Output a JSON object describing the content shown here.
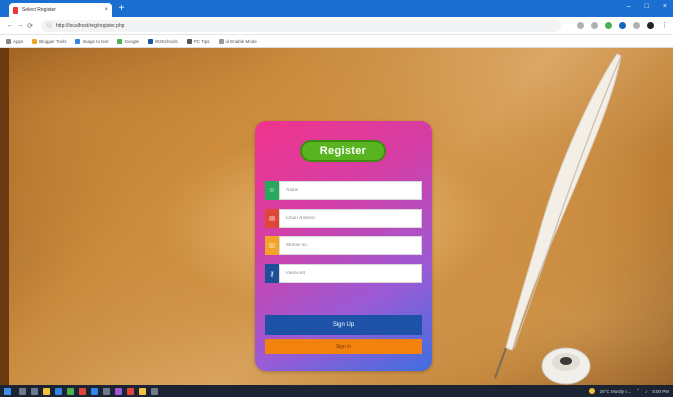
{
  "browser": {
    "tab_title": "Select Register",
    "tab_close": "×",
    "new_tab": "+",
    "window_controls": [
      "–",
      "□",
      "×"
    ],
    "url": "http://localhost/reg/register.php",
    "bookmarks": [
      "Apps",
      "Blogger Tools",
      "Image to text",
      "Google",
      "W3Schools",
      "PC Tips",
      "ul Enable Mode"
    ]
  },
  "form": {
    "title": "Register",
    "name_placeholder": "Name",
    "email_placeholder": "Email Address",
    "mobile_placeholder": "Mobile no",
    "password_placeholder": "Password",
    "signup_label": "Sign Up",
    "signin_label": "Sign in"
  },
  "taskbar": {
    "weather": "29°C Mostly c...",
    "clock": "9:00 PM"
  },
  "colors": {
    "card_gradient": [
      "#f0348c",
      "#9a5bd6",
      "#3f6fe0"
    ],
    "title_badge": "#58b51f",
    "name_icon": "#26a95c",
    "email_icon": "#e0453a",
    "mobile_icon": "#f2a328",
    "password_icon": "#1d4f98",
    "signup_button": "#1d52a6",
    "signin_button": "#f0820d"
  }
}
